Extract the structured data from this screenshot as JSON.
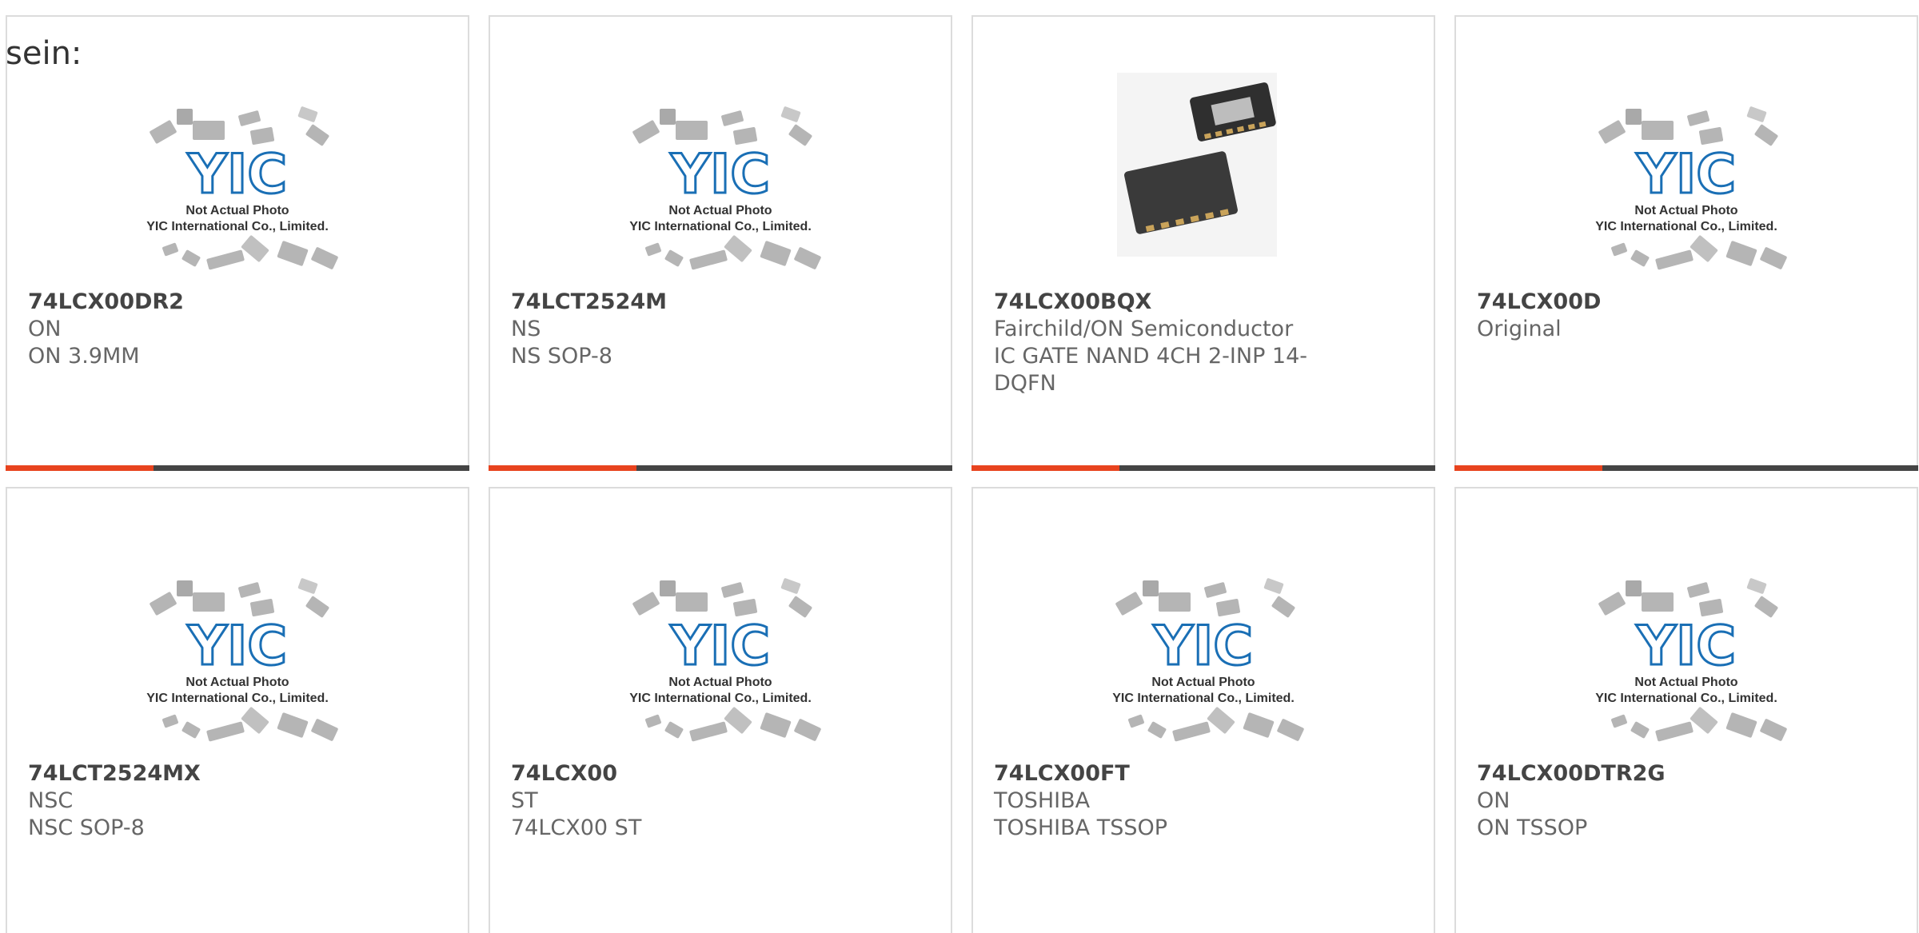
{
  "heading": "sein:",
  "placeholder_image": {
    "line1": "Not Actual Photo",
    "line2": "YIC International Co., Limited."
  },
  "colors": {
    "accent": "#e8431e",
    "bar": "#444444",
    "logo_blue": "#1a6fb5",
    "border": "#dcdcdc"
  },
  "products": [
    {
      "part": "74LCX00DR2",
      "maker": "ON",
      "desc": "ON 3.9MM",
      "image": "placeholder"
    },
    {
      "part": "74LCT2524M",
      "maker": "NS",
      "desc": "NS SOP-8",
      "image": "placeholder"
    },
    {
      "part": "74LCX00BQX",
      "maker": "Fairchild/ON Semiconductor",
      "desc": "IC GATE NAND 4CH 2-INP 14-DQFN",
      "image": "photo"
    },
    {
      "part": "74LCX00D",
      "maker": "Original",
      "desc": "",
      "image": "placeholder"
    },
    {
      "part": "74LCT2524MX",
      "maker": "NSC",
      "desc": "NSC SOP-8",
      "image": "placeholder"
    },
    {
      "part": "74LCX00",
      "maker": "ST",
      "desc": "74LCX00 ST",
      "image": "placeholder"
    },
    {
      "part": "74LCX00FT",
      "maker": "TOSHIBA",
      "desc": "TOSHIBA TSSOP",
      "image": "placeholder"
    },
    {
      "part": "74LCX00DTR2G",
      "maker": "ON",
      "desc": "ON TSSOP",
      "image": "placeholder"
    }
  ]
}
